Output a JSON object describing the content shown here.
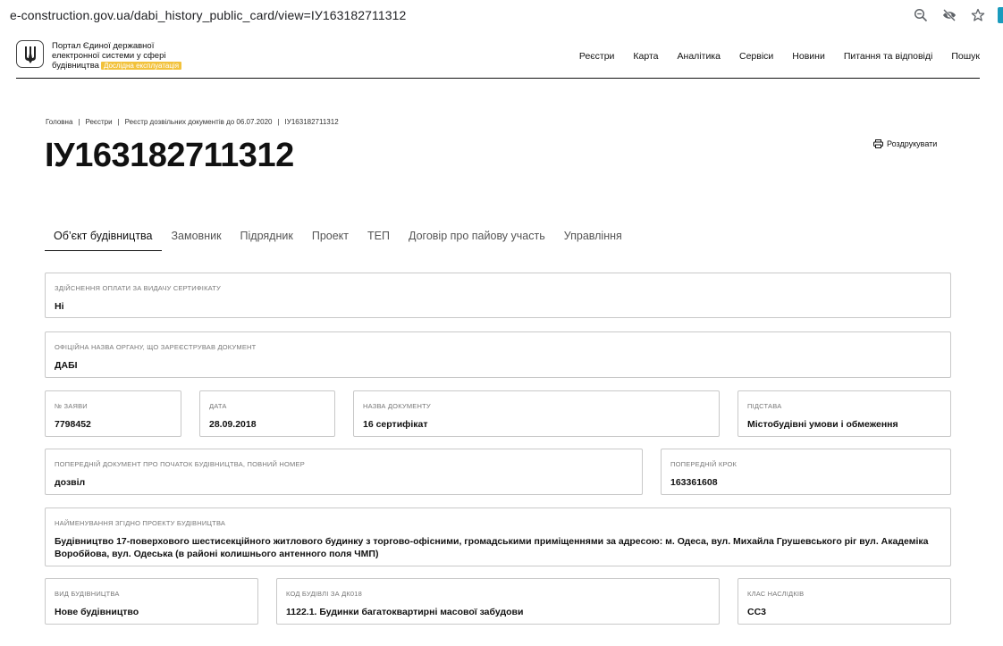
{
  "browser": {
    "url": "e-construction.gov.ua/dabi_history_public_card/view=ІУ163182711312"
  },
  "header": {
    "logo_line1": "Портал Єдиної державної",
    "logo_line2": "електронної системи у сфері",
    "logo_line3": "будівництва",
    "badge": "Дослідна експлуатація",
    "nav": [
      "Реєстри",
      "Карта",
      "Аналітика",
      "Сервіси",
      "Новини",
      "Питання та відповіді",
      "Пошук"
    ]
  },
  "breadcrumb": [
    "Головна",
    "Реєстри",
    "Реєстр дозвільних документів до 06.07.2020",
    "ІУ163182711312"
  ],
  "page": {
    "title": "ІУ163182711312",
    "print_label": "Роздрукувати"
  },
  "tabs": [
    "Об’єкт будівництва",
    "Замовник",
    "Підрядник",
    "Проект",
    "ТЕП",
    "Договір про пайову участь",
    "Управління"
  ],
  "fields": {
    "payment": {
      "label": "Здійснення оплати за видачу сертифікату",
      "value": "Ні"
    },
    "authority": {
      "label": "Офіційна назва органу, що зареєстрував документ",
      "value": "ДАБІ"
    },
    "app_no": {
      "label": "№ заяви",
      "value": "7798452"
    },
    "date": {
      "label": "Дата",
      "value": "28.09.2018"
    },
    "doc_name": {
      "label": "Назва документу",
      "value": "16 сертифікат"
    },
    "basis": {
      "label": "Підстава",
      "value": "Містобудівні умови і обмеження"
    },
    "prev_doc": {
      "label": "Попередній документ про початок будівництва, повний номер",
      "value": "дозвіл"
    },
    "prev_step": {
      "label": "Попередній крок",
      "value": "163361608"
    },
    "project_name": {
      "label": "Найменування згідно проекту будівництва",
      "value": "Будівництво 17-поверхового шестисекційного житлового будинку з торгово-офісними, громадськими приміщеннями за адресою: м. Одеса, вул. Михайла Грушевського ріг вул. Академіка Воробйова, вул. Одеська (в районі колишнього антенного поля ЧМП)"
    },
    "construction_type": {
      "label": "Вид будівництва",
      "value": "Нове будівництво"
    },
    "building_code": {
      "label": "Код будівлі за ДК018",
      "value": "1122.1. Будинки багатоквартирні масової забудови"
    },
    "consequence_class": {
      "label": "Клас наслідків",
      "value": "СС3"
    }
  }
}
